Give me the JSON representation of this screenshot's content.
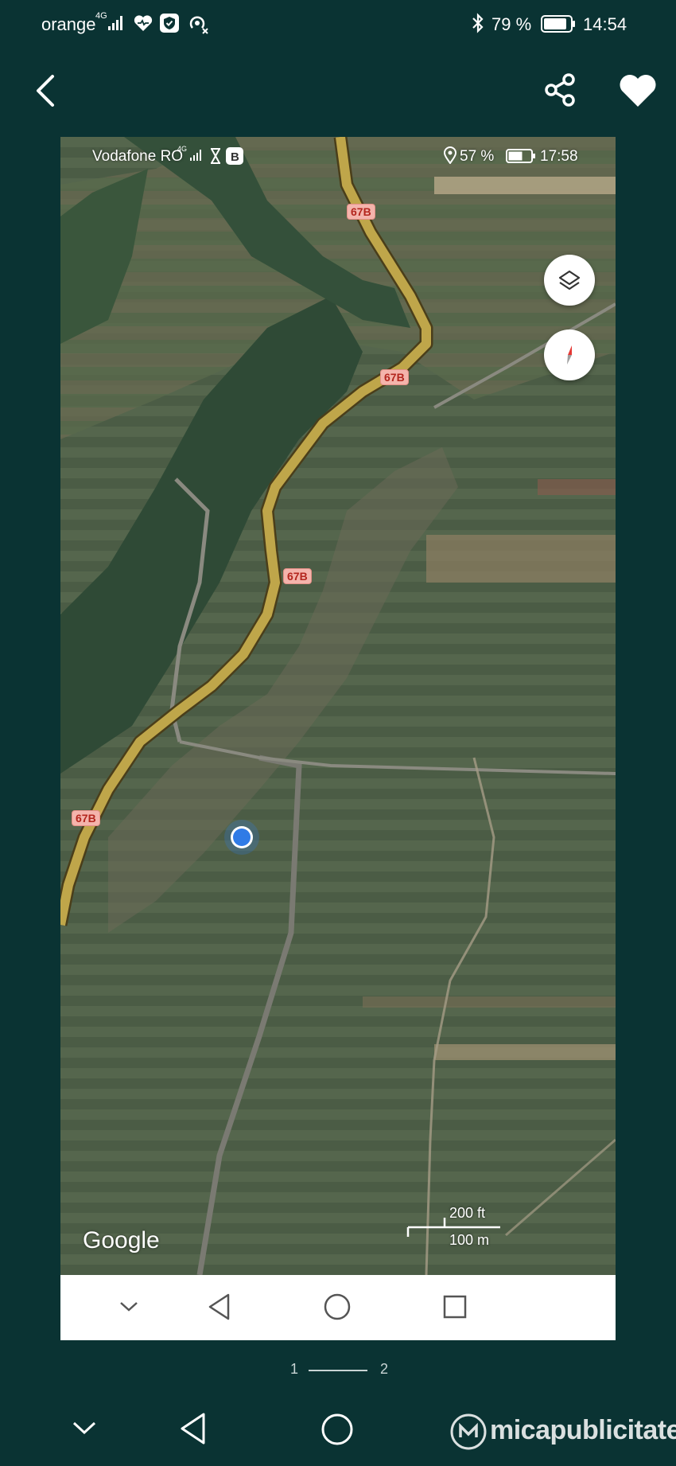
{
  "status_bar": {
    "carrier": "orange",
    "network": "4G",
    "battery": "79 %",
    "time": "14:54"
  },
  "toolbar": {
    "back_icon": "chevron-left-icon",
    "share_icon": "share-icon",
    "favorite_icon": "heart-icon"
  },
  "inner_screenshot": {
    "status_bar": {
      "carrier": "Vodafone RO",
      "network": "4G",
      "battery": "57 %",
      "time": "17:58"
    },
    "map": {
      "route_labels": [
        "67B",
        "67B",
        "67B",
        "67B"
      ],
      "attribution": "Google",
      "scale": {
        "imperial": "200 ft",
        "metric": "100 m"
      },
      "colors": {
        "road": "#bfa64a",
        "location": "#2f7be6"
      }
    },
    "nav_bar": [
      "chevron-down-icon",
      "back-triangle-icon",
      "home-circle-icon",
      "recents-square-icon"
    ]
  },
  "pager": {
    "current": "1",
    "total": "2"
  },
  "bottom_nav": [
    "chevron-down-icon",
    "back-triangle-icon",
    "home-circle-icon"
  ],
  "watermark": "micapublicitate"
}
